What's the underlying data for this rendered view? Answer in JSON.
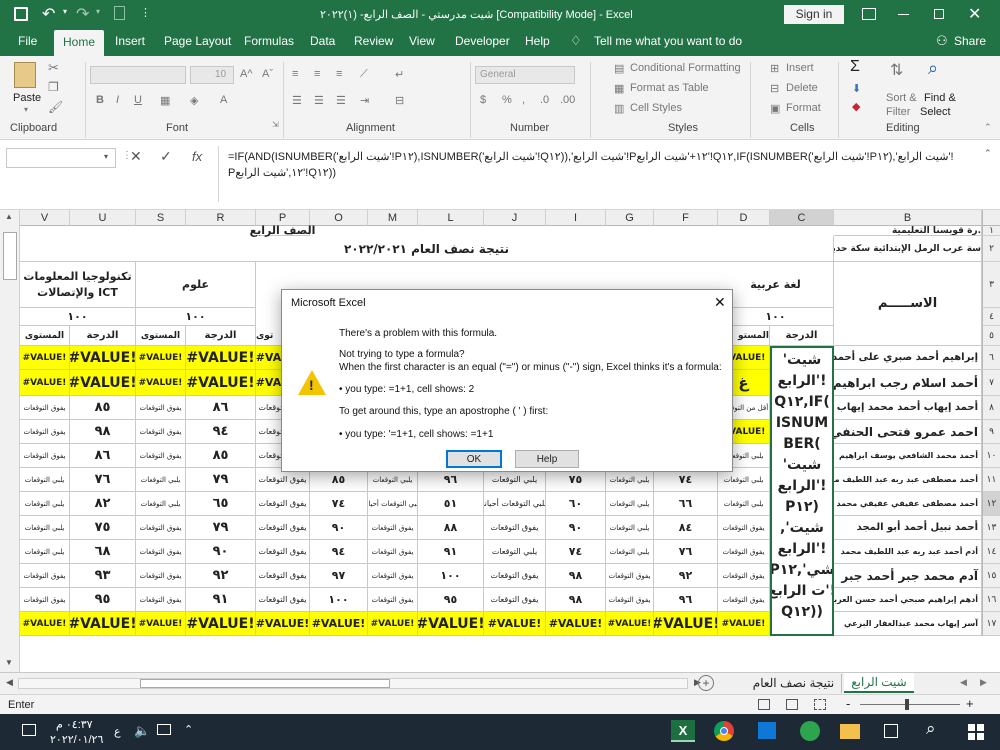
{
  "title": {
    "text": "شيت  مدرستي  - الصف الرابع- (١)٢٠٢٢  [Compatibility Mode]  -  Excel",
    "signin": "Sign in"
  },
  "tabs": [
    "File",
    "Home",
    "Insert",
    "Page Layout",
    "Formulas",
    "Data",
    "Review",
    "View",
    "Developer",
    "Help",
    "Tell me what you want to do",
    "Share"
  ],
  "ribbon": {
    "paste": "Paste",
    "clipboard": "Clipboard",
    "font": "Font",
    "alignment": "Alignment",
    "number": "Number",
    "styles": "Styles",
    "cells": "Cells",
    "editing": "Editing",
    "font_size": "10",
    "number_format": "General",
    "conditional": "Conditional Formatting",
    "format_table": "Format as Table",
    "cell_styles": "Cell Styles",
    "insert": "Insert",
    "delete": "Delete",
    "format": "Format",
    "sort": "Sort &",
    "filter": "Filter",
    "find": "Find &",
    "select": "Select"
  },
  "formula": {
    "fx": "fx",
    "line1": "=IF(AND(ISNUMBER('شيت الرابع'!P١٢),ISNUMBER('شيت الرابع'!Q١٢)),'شيت الرابع'!P١٢+'شيت الرابع'!Q١٢,IF(ISNUMBER('شيت الرابع'!P١٢),'شيت الرابع'!",
    "line2": "P١٢,'شيت الرابع'!Q١٢))"
  },
  "columns": [
    "V",
    "U",
    "S",
    "R",
    "P",
    "O",
    "M",
    "L",
    "J",
    "I",
    "G",
    "F",
    "D",
    "C",
    "B"
  ],
  "rows": [
    "١",
    "٢",
    "٣",
    "٤",
    "٥",
    "٦",
    "٧",
    "٨",
    "٩",
    "١٠",
    "١١",
    "١٢",
    "١٣",
    "١٤",
    "١٥",
    "١٦",
    "١٧"
  ],
  "sheet": {
    "school_top": "رة قويسنا التعليمية.",
    "class": "الصف الرابع",
    "result_title": "نتيجة نصف العام ٢٠٢٢/٢٠٢١",
    "school": "سة عرب الرمل الإبتدائية سكة حديد",
    "subj_ict": "تكنولوجيا المعلومات والإتصالات ICT",
    "subj_sci": "علوم",
    "subj_ar": "لغة عربية",
    "max": "١٠٠",
    "name_hdr": "الاســـــم",
    "grade": "الدرجة",
    "level": "المستوى",
    "level_cut": "توى",
    "level_cut2": "المستو",
    "err": "#VALUE!",
    "exceeds": "يفوق التوقعات",
    "meets": "يلبي التوقعات",
    "meets_sometimes": "يلبي التوقعات أحيانا",
    "below": "أقل من التوقعات",
    "cut": "غ",
    "names": [
      "إبراهيم أحمد صبري على أحمد",
      "أحمد اسلام رجب ابراهيم",
      "أحمد إيهاب أحمد محمد إيهاب",
      "احمد عمرو فتحى الحنفي",
      "أحمد محمد الشافعي يوسف ابراهيم",
      "أحمد مصطفى عبد ربه عبد اللطيف محمد",
      "أحمد مصطفى عفيفي عفيفي محمد عيسي",
      "أحمد نبيل أحمد أبو المجد",
      "أدم أحمد عبد ربه عبد اللطيف محمد",
      "آدم محمد جبر أحمد جبر",
      "أدهم إبراهيم صبحي أحمد حسن العربى",
      "آسر إيهاب محمد عبدالغفار البرعي"
    ],
    "overflow_text": [
      "شيت'",
      "!'الرابع",
      "Q١٢,IF(",
      "ISNUM",
      "BER(",
      "شيت'",
      "!'الرابع",
      "P١٢)",
      "شيت',",
      "!'الرابع",
      "شي',P١٢",
      "!'ت الرابع",
      "Q١٢))"
    ],
    "u_vals": [
      "٨٥",
      "٩٨",
      "٨٦",
      "٧٦",
      "٨٢",
      "٧٥",
      "٦٨",
      "٩٣",
      "٩٥"
    ],
    "r_vals": [
      "٨٦",
      "٩٤",
      "٨٥",
      "٧٩",
      "٦٥",
      "٧٩",
      "٩٠",
      "٩٢",
      "٩١"
    ],
    "o_vals": [
      "٩١",
      "٨٥",
      "٧٤",
      "٩٠",
      "٩٤",
      "٩٧",
      "١٠٠"
    ],
    "l_vals": [
      "٩٦",
      "٩٦",
      "٥١",
      "٨٨",
      "٩١",
      "١٠٠",
      "٩٥"
    ],
    "i_vals": [
      "٧٥",
      "٧٥",
      "٦٠",
      "٩٠",
      "٧٤",
      "٩٨",
      "٩٨"
    ],
    "f_vals": [
      "٧٤",
      "٧٤",
      "٦٦",
      "٨٤",
      "٧٦",
      "٩٢",
      "٩٦"
    ]
  },
  "sheets": [
    "شيت الرابع",
    "نتيجة نصف العام"
  ],
  "status": {
    "mode": "Enter",
    "zoom": "-"
  },
  "taskbar": {
    "time": "٠٤:٣٧ م",
    "date": "٢٠٢٢/٠١/٢٦",
    "lang": "ع"
  },
  "dialog": {
    "title": "Microsoft Excel",
    "l1": "There's a problem with this formula.",
    "l2": "Not trying to type a formula?",
    "l3": "When the first character is an equal (\"=\") or minus (\"-\") sign, Excel thinks it's a formula:",
    "l4": "• you type:   =1+1, cell shows:   2",
    "l5": "To get around this, type an apostrophe ( ' ) first:",
    "l6": "• you type:   '=1+1, cell shows:   =1+1",
    "ok": "OK",
    "help": "Help"
  }
}
